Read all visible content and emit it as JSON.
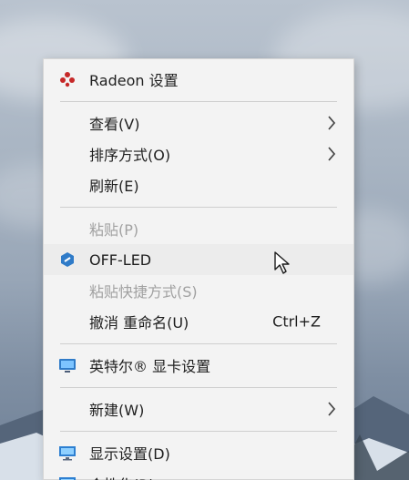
{
  "menu": {
    "radeon": {
      "label": "Radeon 设置",
      "icon": "amd-radeon-icon"
    },
    "view": {
      "label": "查看(V)"
    },
    "sort": {
      "label": "排序方式(O)"
    },
    "refresh": {
      "label": "刷新(E)"
    },
    "paste": {
      "label": "粘贴(P)"
    },
    "offled": {
      "label": "OFF-LED",
      "icon": "hexagon-app-icon"
    },
    "paste_shortcut": {
      "label": "粘贴快捷方式(S)"
    },
    "undo_rename": {
      "label": "撤消 重命名(U)",
      "shortcut": "Ctrl+Z"
    },
    "intel_graphics": {
      "label": "英特尔® 显卡设置",
      "icon": "intel-graphics-icon"
    },
    "new": {
      "label": "新建(W)"
    },
    "display_settings": {
      "label": "显示设置(D)",
      "icon": "monitor-icon"
    },
    "personalize": {
      "label": "个性化(R)",
      "icon": "personalize-icon"
    }
  },
  "colors": {
    "menu_background": "#f3f3f3",
    "separator": "#cfcfcf",
    "text": "#1f1f1f",
    "disabled_text": "#a1a1a1",
    "radeon_red": "#c62828",
    "intel_blue": "#2f7bc8",
    "monitor_blue": "#2d7fd1"
  }
}
